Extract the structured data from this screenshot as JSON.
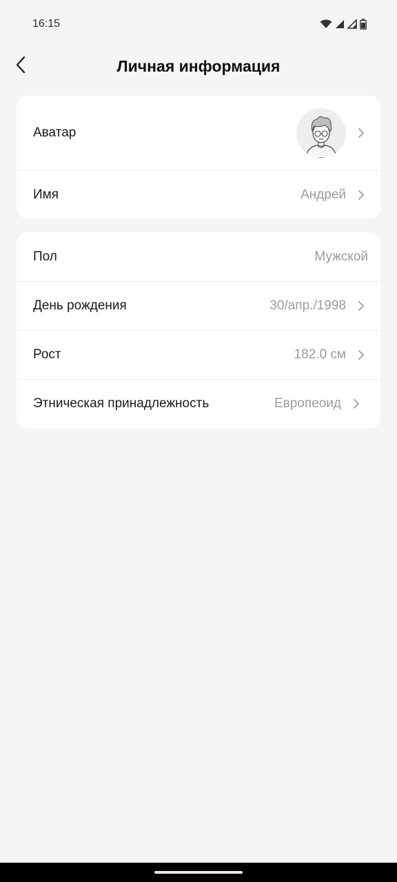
{
  "status_bar": {
    "time": "16:15",
    "icons": [
      "wifi-icon",
      "signal-icon",
      "signal-icon",
      "battery-icon"
    ]
  },
  "header": {
    "title": "Личная информация",
    "back_icon": "chevron-left-icon"
  },
  "card1": {
    "rows": [
      {
        "label": "Аватар",
        "value": "",
        "avatar": true
      },
      {
        "label": "Имя",
        "value": "Андрей"
      }
    ]
  },
  "card2": {
    "rows": [
      {
        "label": "Пол",
        "value": "Мужской"
      },
      {
        "label": "День рождения",
        "value": "30/апр./1998"
      },
      {
        "label": "Рост",
        "value": "182.0 см"
      },
      {
        "label": "Этническая принадлежность",
        "value": "Европеоид"
      }
    ]
  },
  "colors": {
    "background": "#f5f5f5",
    "card": "#ffffff",
    "label": "#1a1a1a",
    "value": "#9a9aa2",
    "chevron": "#9a9aa2"
  }
}
